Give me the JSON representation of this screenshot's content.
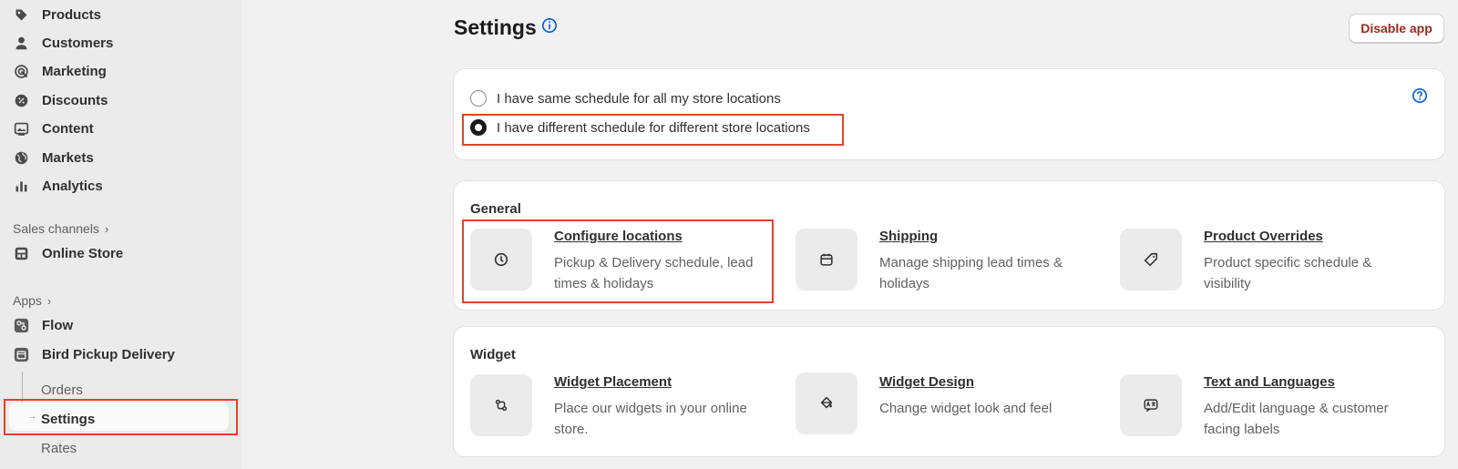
{
  "sidebar": {
    "nav": [
      {
        "label": "Products",
        "icon": "tag-icon"
      },
      {
        "label": "Customers",
        "icon": "person-icon"
      },
      {
        "label": "Marketing",
        "icon": "target-icon"
      },
      {
        "label": "Discounts",
        "icon": "discount-icon"
      },
      {
        "label": "Content",
        "icon": "image-icon"
      },
      {
        "label": "Markets",
        "icon": "globe-icon"
      },
      {
        "label": "Analytics",
        "icon": "bar-chart-icon"
      }
    ],
    "sales_channels_label": "Sales channels",
    "online_store_label": "Online Store",
    "apps_label": "Apps",
    "flow_label": "Flow",
    "bird_label": "Bird Pickup Delivery",
    "sub_items": [
      "Orders",
      "Settings",
      "Rates"
    ]
  },
  "header": {
    "title": "Settings",
    "disable_button": "Disable app"
  },
  "schedule": {
    "options": [
      {
        "label": "I have same schedule for all my store locations",
        "checked": false
      },
      {
        "label": "I have different schedule for different store locations",
        "checked": true
      }
    ]
  },
  "general": {
    "title": "General",
    "tiles": [
      {
        "title": "Configure locations",
        "desc": "Pickup & Delivery schedule, lead times & holidays",
        "icon": "clock-icon"
      },
      {
        "title": "Shipping",
        "desc": "Manage shipping lead times & holidays",
        "icon": "calendar-icon"
      },
      {
        "title": "Product Overrides",
        "desc": "Product specific schedule & visibility",
        "icon": "tag-icon"
      }
    ]
  },
  "widget": {
    "title": "Widget",
    "tiles": [
      {
        "title": "Widget Placement",
        "desc": "Place our widgets in your online store.",
        "icon": "swap-icon"
      },
      {
        "title": "Widget Design",
        "desc": "Change widget look and feel",
        "icon": "paint-bucket-icon"
      },
      {
        "title": "Text and Languages",
        "desc": "Add/Edit language & customer facing labels",
        "icon": "language-icon"
      }
    ]
  },
  "colors": {
    "accent_blue": "#005bd3",
    "highlight_red": "#e0432b",
    "critical_text": "#a0271b"
  }
}
